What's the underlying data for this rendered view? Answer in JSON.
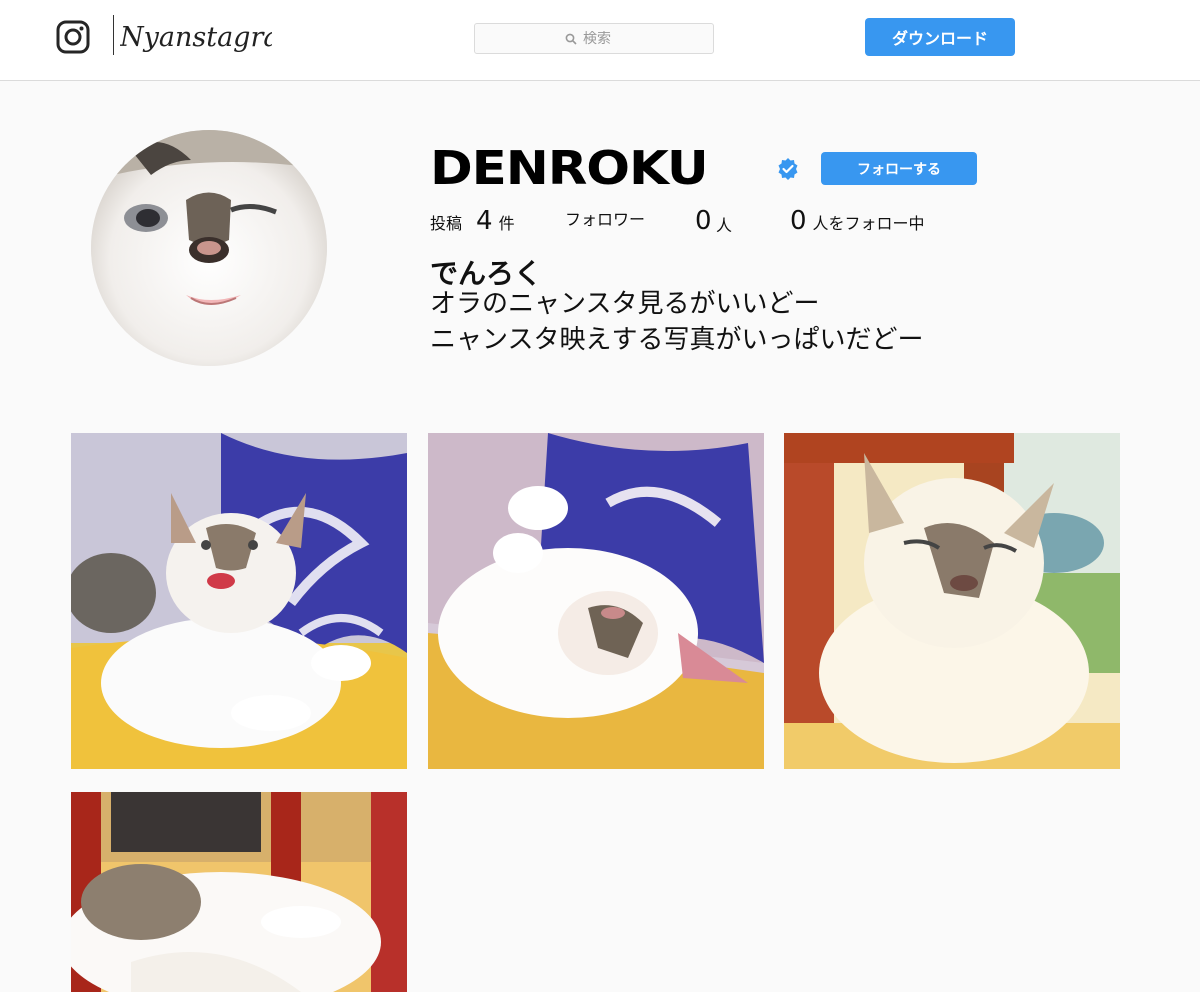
{
  "header": {
    "logo_text": "Nyanstagram",
    "search_placeholder": "検索",
    "download_label": "ダウンロード"
  },
  "profile": {
    "username": "DENROKU",
    "follow_label": "フォローする",
    "stats": {
      "posts_label": "投稿",
      "posts_count": "4",
      "posts_unit": "件",
      "followers_label": "フォロワー",
      "followers_count": "0",
      "followers_unit": "人",
      "following_count": "0",
      "following_label": "人をフォロー中"
    },
    "full_name": "でんろく",
    "bio_lines": [
      "オラのニャンスタ見るがいいどー",
      "ニャンスタ映えする写真がいっぱいだどー"
    ]
  },
  "colors": {
    "accent": "#3897f0",
    "header_bg": "#ffffff",
    "page_bg": "#fafafa"
  },
  "posts": [
    {
      "icon": "cat-photo"
    },
    {
      "icon": "cat-photo"
    },
    {
      "icon": "cat-photo"
    },
    {
      "icon": "cat-photo"
    }
  ]
}
